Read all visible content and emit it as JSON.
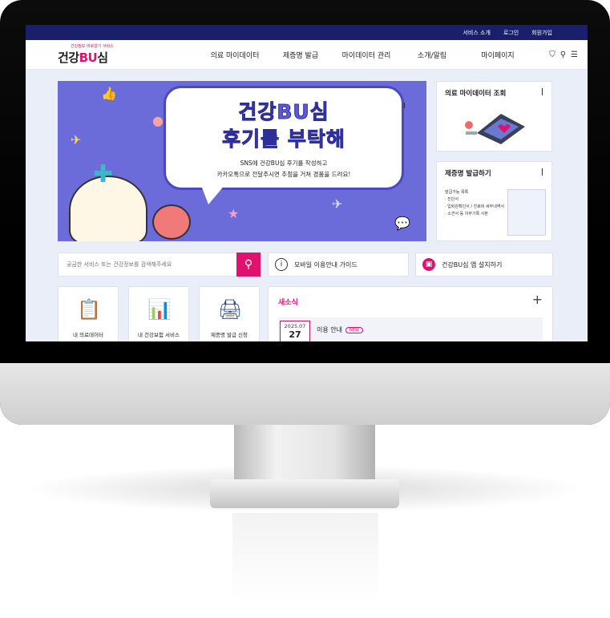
{
  "utility_nav": [
    "서비스 소개",
    "로그인",
    "회원가입"
  ],
  "logo": {
    "subtitle": "건강정보 바로알기 서비스",
    "main_prefix": "건강",
    "main_accent": "BU",
    "main_suffix": "심"
  },
  "menu": [
    "의료 마이데이터",
    "제증명 발급",
    "마이데이터 관리",
    "소개/알림",
    "마이페이지"
  ],
  "banner": {
    "title_line1": "건강BU심",
    "title_line2": "후기를 부탁해",
    "desc_line1": "SNS에 건강BU심 후기를 작성하고",
    "desc_line2": "카카오톡으로 전달주시면 추첨을 거쳐 경품을 드려요!"
  },
  "side_cards": {
    "card1_title": "의료 마이데이터 조회",
    "card2_title": "제증명 발급하기",
    "card2_list": [
      "발급가능 목록",
      "· 진단서",
      "· 입퇴원확인서 / 진료비 세부내역서",
      "· 소견서 등 의무기록 사본"
    ]
  },
  "search": {
    "placeholder": "궁금한 서비스 또는 건강정보를 검색해주세요"
  },
  "quick_links": [
    {
      "label": "모바일 이용안내 가이드",
      "icon": "info-icon"
    },
    {
      "label": "건강BU심 앱 설치하기",
      "icon": "app-icon"
    }
  ],
  "services": [
    {
      "label": "내 의료데이터",
      "icon": "clipboard-icon"
    },
    {
      "label": "내 건강보험 서비스",
      "icon": "monitor-chart-icon"
    },
    {
      "label": "제증명 발급 신청",
      "icon": "printer-icon"
    }
  ],
  "news": {
    "title": "새소식",
    "plus": "+",
    "item_year_month": "2025.07",
    "item_day": "27",
    "item_title": "이용 안내",
    "item_badge": "NEW"
  },
  "colors": {
    "brand": "#e0126e",
    "navy": "#1a1f6b",
    "banner": "#6b6bd9"
  }
}
